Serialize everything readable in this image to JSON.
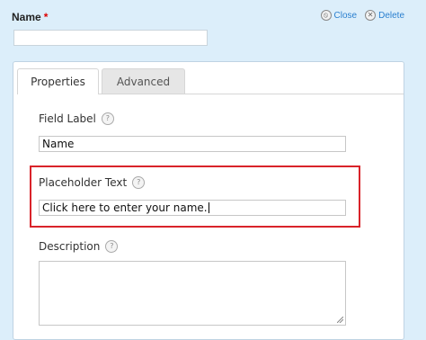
{
  "field": {
    "title": "Name",
    "required_marker": "*"
  },
  "actions": {
    "close_label": "Close",
    "delete_label": "Delete",
    "close_icon": "circle-slash-icon",
    "delete_icon": "circle-x-icon"
  },
  "preview": {
    "value": ""
  },
  "tabs": [
    {
      "label": "Properties",
      "active": true
    },
    {
      "label": "Advanced",
      "active": false
    }
  ],
  "settings": {
    "field_label": {
      "label": "Field Label",
      "value": "Name",
      "help_icon": "help-icon"
    },
    "placeholder": {
      "label": "Placeholder Text",
      "value": "Click here to enter your name.",
      "help_icon": "help-icon"
    },
    "description": {
      "label": "Description",
      "value": "",
      "help_icon": "help-icon"
    }
  },
  "colors": {
    "highlight": "#d9232a",
    "link": "#2a7fcf",
    "required": "#dd0000"
  }
}
